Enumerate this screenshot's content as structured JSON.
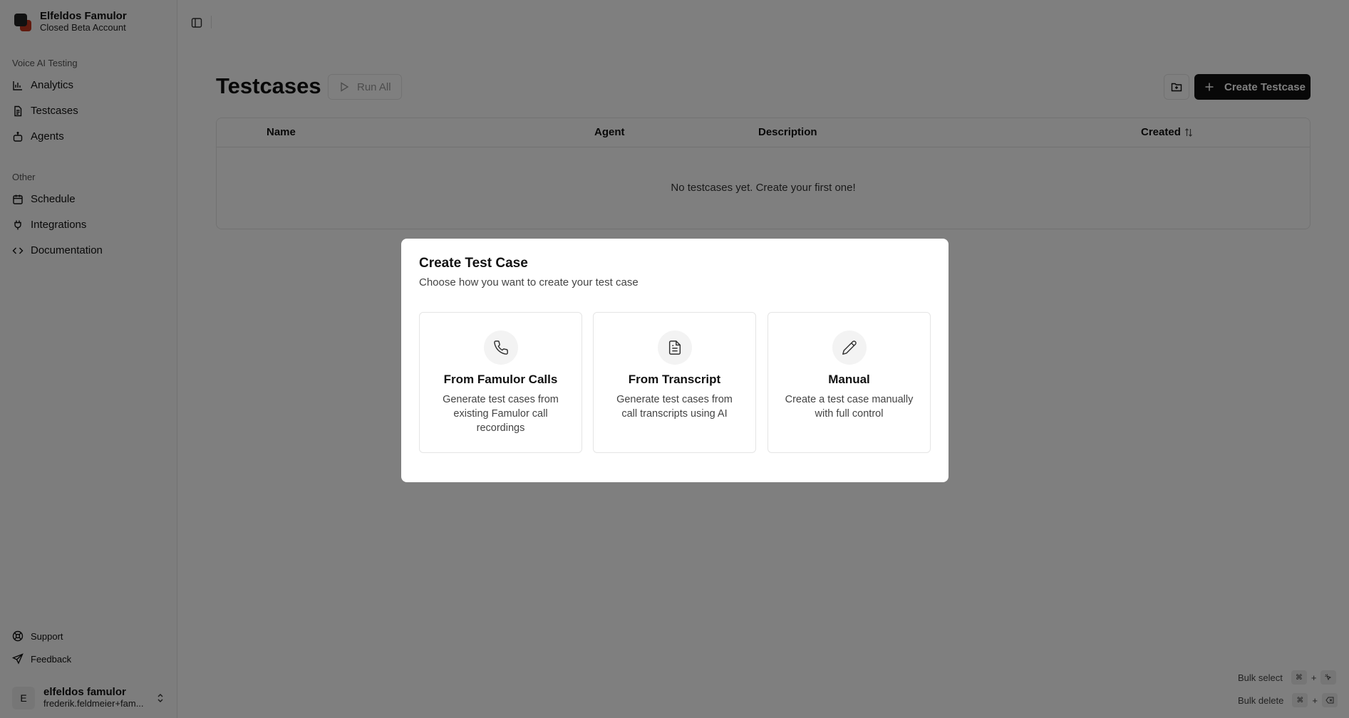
{
  "workspace": {
    "name": "Elfeldos Famulor",
    "plan": "Closed Beta Account"
  },
  "sidebar": {
    "group1": "Voice AI Testing",
    "items1": [
      {
        "label": "Analytics",
        "icon": "bar-chart-icon"
      },
      {
        "label": "Testcases",
        "icon": "document-icon"
      },
      {
        "label": "Agents",
        "icon": "bot-icon"
      }
    ],
    "group2": "Other",
    "items2": [
      {
        "label": "Schedule",
        "icon": "calendar-icon"
      },
      {
        "label": "Integrations",
        "icon": "plug-icon"
      },
      {
        "label": "Documentation",
        "icon": "code-icon"
      }
    ],
    "footer": [
      {
        "label": "Support",
        "icon": "lifebuoy-icon"
      },
      {
        "label": "Feedback",
        "icon": "send-icon"
      }
    ],
    "user": {
      "initial": "E",
      "name": "elfeldos famulor",
      "email": "frederik.feldmeier+fam..."
    }
  },
  "page": {
    "title": "Testcases",
    "run_all": "Run All",
    "create": "Create Testcase",
    "columns": [
      "Name",
      "Agent",
      "Description",
      "Created"
    ],
    "empty": "No testcases yet. Create your first one!",
    "bulk_select": "Bulk select",
    "bulk_delete": "Bulk delete",
    "kbd_cmd": "⌘",
    "kbd_plus": "+"
  },
  "modal": {
    "title": "Create Test Case",
    "subtitle": "Choose how you want to create your test case",
    "options": [
      {
        "title": "From Famulor Calls",
        "desc": "Generate test cases from existing Famulor call recordings",
        "icon": "phone-icon"
      },
      {
        "title": "From Transcript",
        "desc": "Generate test cases from call transcripts using AI",
        "icon": "file-text-icon"
      },
      {
        "title": "Manual",
        "desc": "Create a test case manually with full control",
        "icon": "pencil-icon"
      }
    ]
  },
  "colors": {
    "overlay": "rgba(0,0,0,0.5)",
    "primary": "#111111",
    "logo_accent": "#c2371f"
  }
}
